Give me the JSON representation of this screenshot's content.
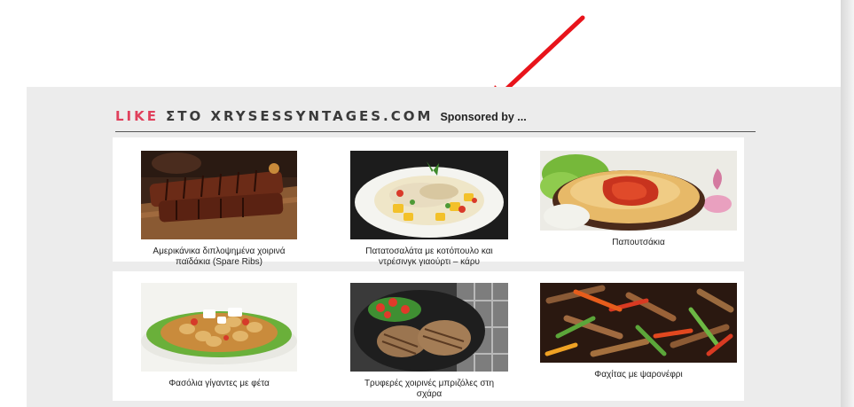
{
  "widget": {
    "title_like": "LIKE",
    "title_rest": "ΣΤΟ XRYSESSYNTAGES.COM",
    "sponsored": "Sponsored by ...",
    "accent_color": "#e0405c",
    "annotation_arrow_color": "#e8141b"
  },
  "recipes": [
    {
      "title": "Αμερικάνικα διπλοψημένα χοιρινά παϊδάκια (Spare Ribs)",
      "icon": "ribs-image"
    },
    {
      "title": "Πατατοσαλάτα με κοτόπουλο και ντρέσινγκ γιαούρτι – κάρυ",
      "icon": "potato-salad-image"
    },
    {
      "title": "Παπουτσάκια",
      "icon": "papoutsakia-image"
    },
    {
      "title": "Φασόλια γίγαντες με φέτα",
      "icon": "beans-image"
    },
    {
      "title": "Τρυφερές χοιρινές μπριζόλες στη σχάρα",
      "icon": "pork-chops-image"
    },
    {
      "title": "Φαχίτας με ψαρονέφρι",
      "icon": "fajitas-image"
    }
  ]
}
